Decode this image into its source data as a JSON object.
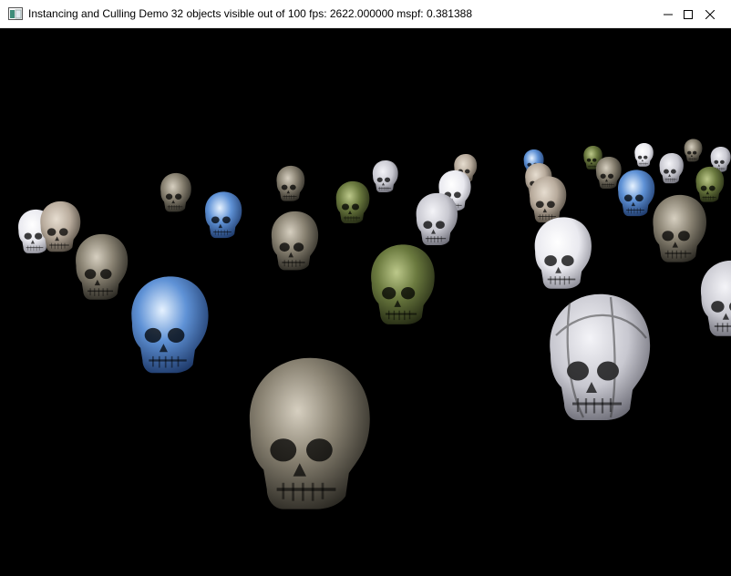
{
  "window": {
    "title": "Instancing and Culling Demo    32 objects visible out of 100    fps: 2622.000000    mspf: 0.381388"
  },
  "controls": {
    "minimize_icon": "minimize-icon",
    "maximize_icon": "maximize-icon",
    "close_icon": "close-icon"
  },
  "scene": {
    "background": "#000000",
    "skull_materials": {
      "stone": "#8a8373",
      "ice_blue": "#5f92d6",
      "moss_green": "#6b7a3f",
      "white": "#e9e9ef",
      "checker": "#c8c8d0",
      "marble": "#b8ab9c"
    }
  }
}
